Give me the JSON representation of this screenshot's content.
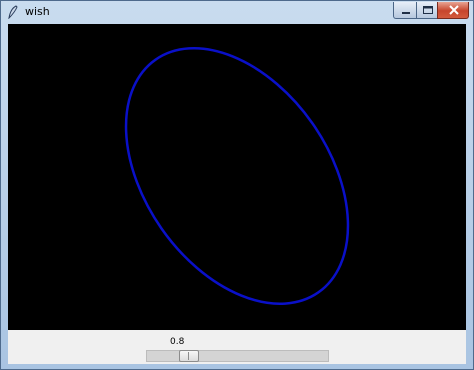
{
  "window": {
    "title": "wish",
    "controls": [
      "minimize-icon",
      "maximize-icon",
      "close-icon"
    ]
  },
  "canvas": {
    "background": "#000000",
    "shape": "ellipse",
    "stroke_color": "#0a10c8"
  },
  "scale": {
    "value": "0.8",
    "fraction": 0.2
  }
}
